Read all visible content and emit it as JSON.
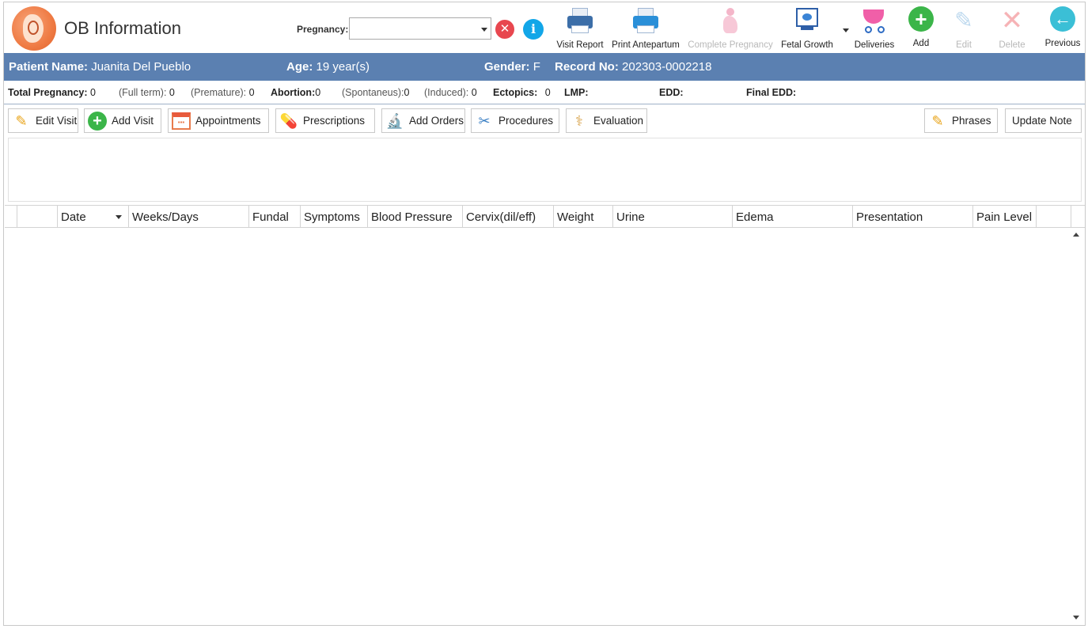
{
  "header": {
    "title": "OB Information",
    "pregnancy_label": "Pregnancy:",
    "pregnancy_value": "",
    "clear_glyph": "✕",
    "info_glyph": "i"
  },
  "toolbar": {
    "items": [
      {
        "label": "Visit Report",
        "icon": "printer-icon",
        "enabled": true
      },
      {
        "label": "Print Antepartum",
        "icon": "printer-icon",
        "enabled": true
      },
      {
        "label": "Complete Pregnancy",
        "icon": "pregnant-woman-icon",
        "enabled": false
      },
      {
        "label": "Fetal Growth",
        "icon": "ultrasound-monitor-icon",
        "enabled": true
      },
      {
        "label": "Deliveries",
        "icon": "stroller-icon",
        "enabled": true
      },
      {
        "label": "Add",
        "icon": "plus-circle-icon",
        "enabled": true
      },
      {
        "label": "Edit",
        "icon": "pencil-icon",
        "enabled": false
      },
      {
        "label": "Delete",
        "icon": "close-x-icon",
        "enabled": false
      },
      {
        "label": "Previous",
        "icon": "arrow-left-circle-icon",
        "enabled": true
      }
    ]
  },
  "patient": {
    "name_label": "Patient Name:",
    "name": "Juanita Del Pueblo",
    "age_label": "Age:",
    "age": "19 year(s)",
    "gender_label": "Gender:",
    "gender": "F",
    "record_label": "Record No:",
    "record": "202303-0002218"
  },
  "stats": {
    "total_pregnancy_label": "Total Pregnancy:",
    "total_pregnancy": "0",
    "full_term_label": "(Full term):",
    "full_term": "0",
    "premature_label": "(Premature):",
    "premature": "0",
    "abortion_label": "Abortion:",
    "abortion": "0",
    "spontaneus_label": "(Spontaneus):",
    "spontaneus": "0",
    "induced_label": "(Induced):",
    "induced": "0",
    "ectopics_label": "Ectopics:",
    "ectopics": "0",
    "lmp_label": "LMP:",
    "edd_label": "EDD:",
    "final_edd_label": "Final EDD:"
  },
  "actions": {
    "edit_visit": "Edit Visit",
    "add_visit": "Add Visit",
    "appointments": "Appointments",
    "prescriptions": "Prescriptions",
    "add_orders": "Add Orders",
    "procedures": "Procedures",
    "evaluation": "Evaluation",
    "phrases": "Phrases",
    "update_note": "Update Note"
  },
  "grid": {
    "columns": [
      "Date",
      "Weeks/Days",
      "Fundal",
      "Symptoms",
      "Blood Pressure",
      "Cervix(dil/eff)",
      "Weight",
      "Urine",
      "Edema",
      "Presentation",
      "Pain Level"
    ],
    "rows": []
  },
  "colors": {
    "patient_bar": "#5b80b1",
    "add_green": "#3bb549",
    "clear_red": "#e8474f",
    "info_blue": "#12a6e8",
    "previous_teal": "#3bbfd6"
  }
}
